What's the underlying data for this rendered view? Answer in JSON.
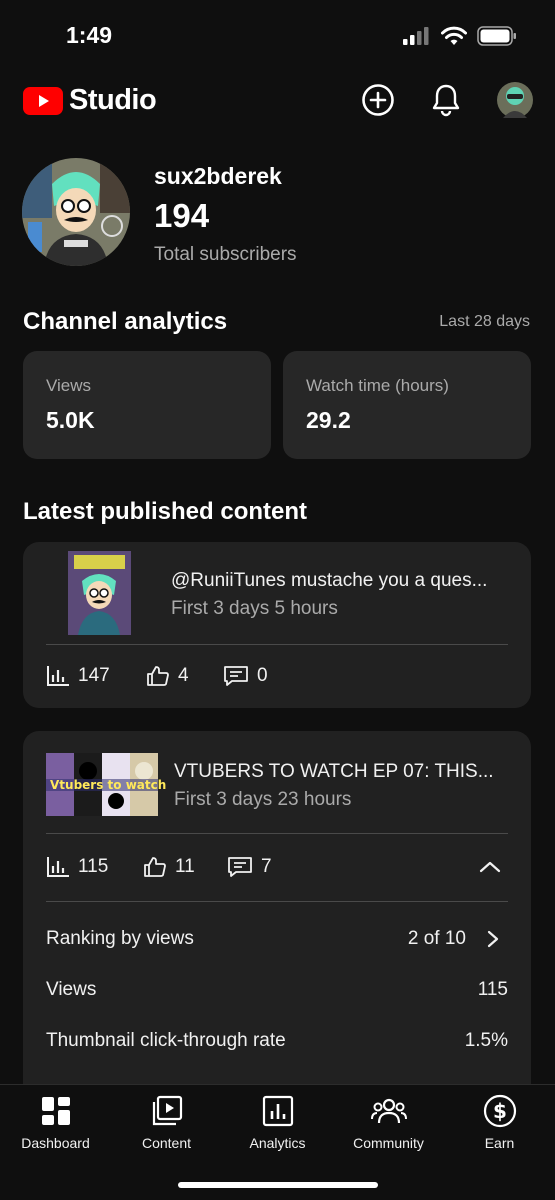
{
  "status_bar": {
    "time": "1:49"
  },
  "header": {
    "logo_text": "Studio"
  },
  "channel": {
    "name": "sux2bderek",
    "subscribers": "194",
    "subscribers_label": "Total subscribers"
  },
  "analytics": {
    "title": "Channel analytics",
    "period": "Last 28 days",
    "cards": [
      {
        "label": "Views",
        "value": "5.0K"
      },
      {
        "label": "Watch time (hours)",
        "value": "29.2"
      }
    ]
  },
  "latest": {
    "title": "Latest published content",
    "items": [
      {
        "title": "@RuniiTunes  mustache you a ques...",
        "subtitle": "First 3 days 5 hours",
        "views": "147",
        "likes": "4",
        "comments": "0",
        "thumb_text": ""
      },
      {
        "title": "VTUBERS TO WATCH EP 07: THIS...",
        "subtitle": "First 3 days 23 hours",
        "views": "115",
        "likes": "11",
        "comments": "7",
        "thumb_text": "Vtubers to watch",
        "details": [
          {
            "label": "Ranking by views",
            "value": "2 of 10"
          },
          {
            "label": "Views",
            "value": "115"
          },
          {
            "label": "Thumbnail click-through rate",
            "value": "1.5%"
          }
        ]
      }
    ]
  },
  "nav": {
    "items": [
      {
        "label": "Dashboard",
        "icon": "dashboard-icon"
      },
      {
        "label": "Content",
        "icon": "content-icon"
      },
      {
        "label": "Analytics",
        "icon": "analytics-icon"
      },
      {
        "label": "Community",
        "icon": "community-icon"
      },
      {
        "label": "Earn",
        "icon": "earn-icon"
      }
    ]
  },
  "colors": {
    "background": "#0f0f0f",
    "card": "#272727",
    "brand_red": "#ff0000"
  }
}
